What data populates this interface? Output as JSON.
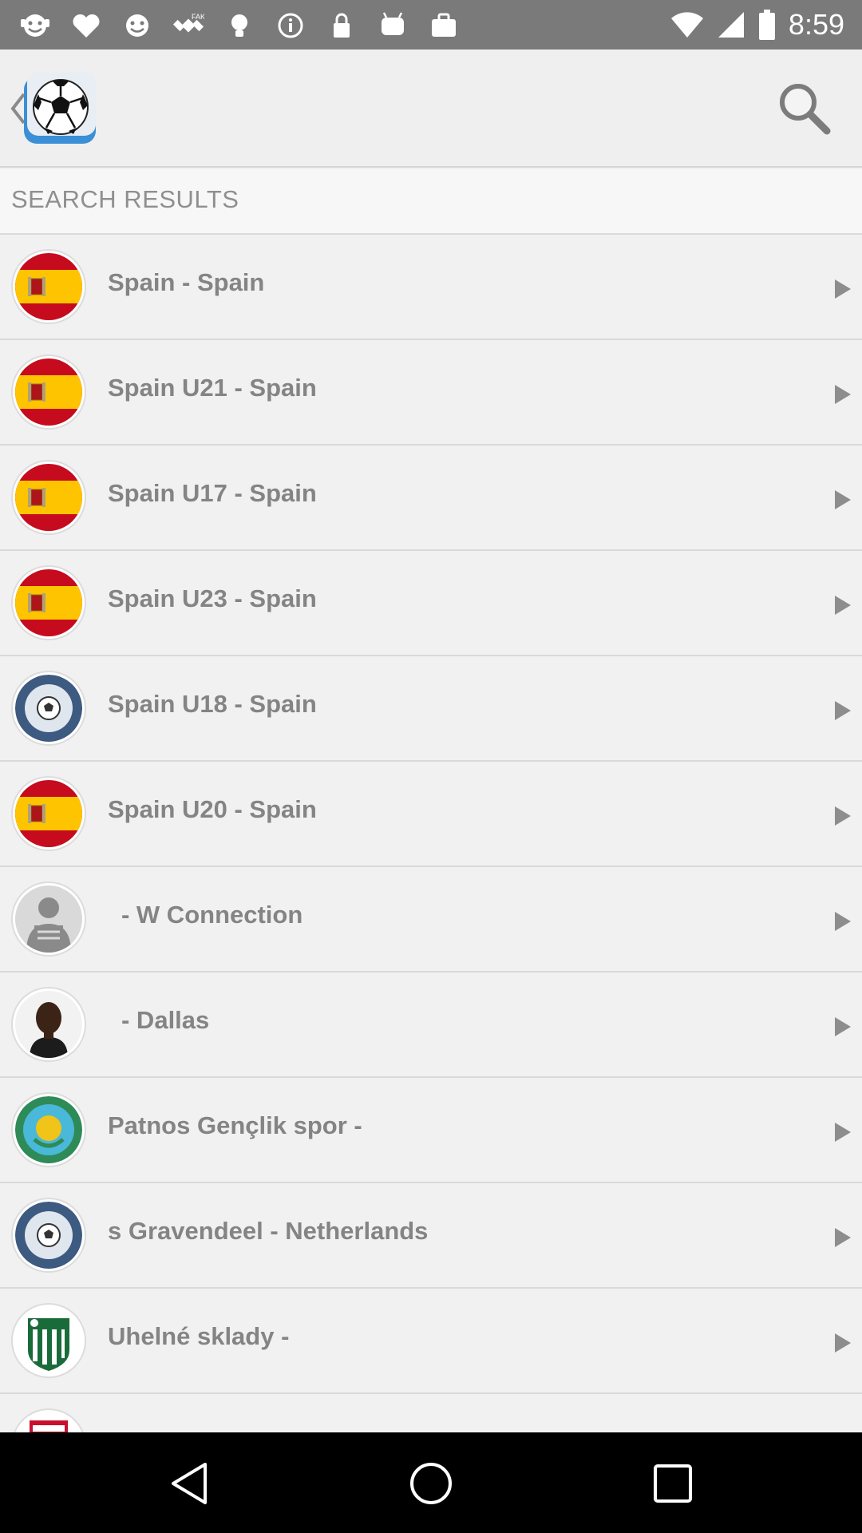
{
  "status_bar": {
    "time": "8:59",
    "icons": [
      "emoji-icon",
      "heart-icon",
      "emoji-icon",
      "fake-gps-icon",
      "bulb-icon",
      "info-icon",
      "lock-icon",
      "android-icon",
      "briefcase-icon"
    ]
  },
  "app_bar": {
    "logo": "soccer-ball-logo",
    "back_icon": "chevron-left-icon",
    "search_icon": "search-icon"
  },
  "section_header": "SEARCH RESULTS",
  "results": [
    {
      "label": "Spain - Spain",
      "avatar": "spain-flag"
    },
    {
      "label": "Spain U21 - Spain",
      "avatar": "spain-flag"
    },
    {
      "label": "Spain U17 - Spain",
      "avatar": "spain-flag"
    },
    {
      "label": "Spain U23 - Spain",
      "avatar": "spain-flag"
    },
    {
      "label": "Spain U18 - Spain",
      "avatar": "no-logo-badge"
    },
    {
      "label": "Spain U20 - Spain",
      "avatar": "spain-flag"
    },
    {
      "label": "- W Connection",
      "avatar": "no-photo"
    },
    {
      "label": "- Dallas",
      "avatar": "player-photo"
    },
    {
      "label": "Patnos Gençlik spor -",
      "avatar": "patnos-badge"
    },
    {
      "label": "s Gravendeel - Netherlands",
      "avatar": "no-logo-badge"
    },
    {
      "label": "Uhelné sklady -",
      "avatar": "uhelne-badge"
    },
    {
      "label": "",
      "avatar": "red-badge"
    }
  ],
  "nav_bar": {
    "back": "back-nav-icon",
    "home": "home-nav-icon",
    "recents": "recents-nav-icon"
  }
}
